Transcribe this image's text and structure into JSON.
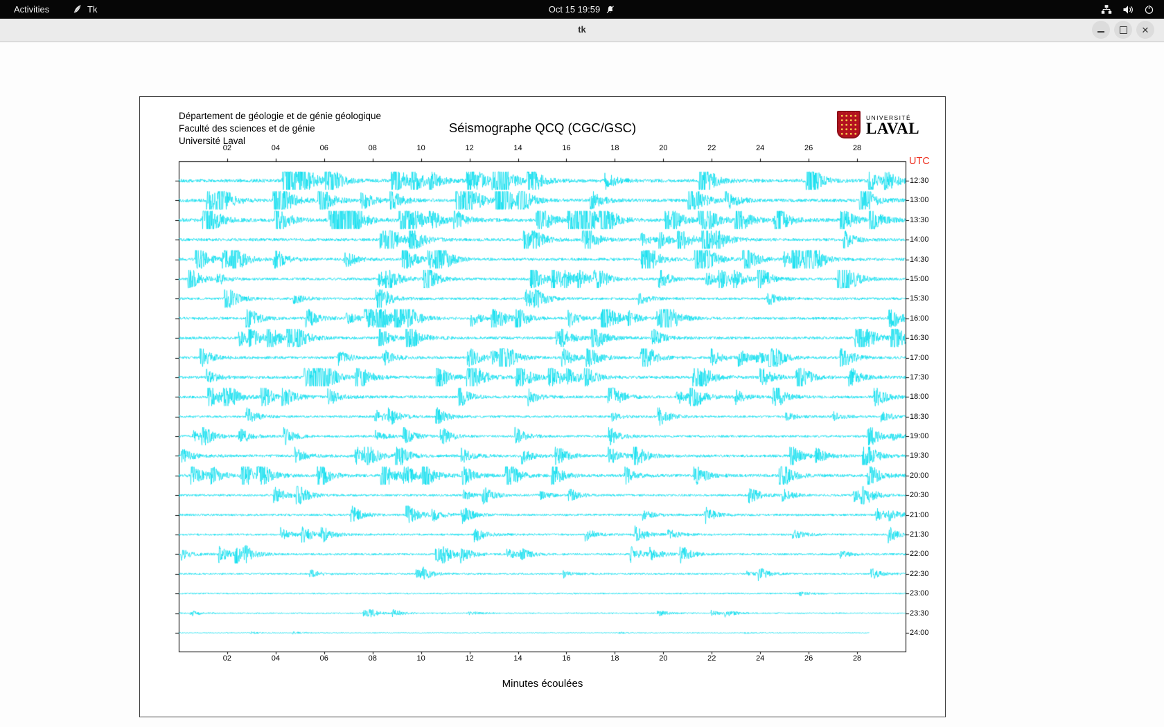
{
  "topbar": {
    "activities_label": "Activities",
    "app_label": "Tk",
    "clock": "Oct 15 19:59"
  },
  "icons": {
    "app": "tk-feather-icon",
    "clock_status": "notifications-muted-icon",
    "system": [
      "network-nodes-icon",
      "volume-icon",
      "power-icon"
    ],
    "window_controls": [
      "minimize-icon",
      "maximize-icon",
      "close-icon"
    ]
  },
  "window": {
    "title": "tk",
    "close_glyph": "✕"
  },
  "panel": {
    "header_lines": [
      "Département de géologie et de génie géologique",
      "Faculté des sciences et de génie",
      "Université Laval"
    ],
    "title": "Séismographe QCQ (CGC/GSC)",
    "logo": {
      "line1": "UNIVERSITÉ",
      "line2": "LAVAL"
    },
    "utc_label": "UTC",
    "xlabel": "Minutes écoulées"
  },
  "chart_data": {
    "type": "seismogram",
    "title": "Séismographe QCQ (CGC/GSC)",
    "xlabel": "Minutes écoulées",
    "x_range_minutes": [
      0,
      30
    ],
    "x_tick_labels": [
      "02",
      "04",
      "06",
      "08",
      "10",
      "12",
      "14",
      "16",
      "18",
      "20",
      "22",
      "24",
      "26",
      "28"
    ],
    "time_labels": [
      "12:30",
      "13:00",
      "13:30",
      "14:00",
      "14:30",
      "15:00",
      "15:30",
      "16:00",
      "16:30",
      "17:00",
      "17:30",
      "18:00",
      "18:30",
      "19:00",
      "19:30",
      "20:00",
      "20:30",
      "21:00",
      "21:30",
      "22:00",
      "22:30",
      "23:00",
      "23:30",
      "24:00"
    ],
    "utc_label": "UTC",
    "trace_color": "#00dcee",
    "row_activity": [
      3.0,
      3.0,
      3.2,
      2.6,
      2.6,
      2.4,
      2.2,
      2.4,
      2.6,
      2.4,
      2.6,
      2.4,
      2.0,
      2.0,
      2.4,
      2.6,
      2.0,
      2.0,
      1.8,
      1.8,
      1.5,
      1.2,
      1.1,
      0.7
    ],
    "last_row_end_minute": 28.5
  },
  "colors": {
    "accent_red": "#ee2e1e",
    "trace": "#00dcee",
    "topbar_bg": "#060606"
  }
}
